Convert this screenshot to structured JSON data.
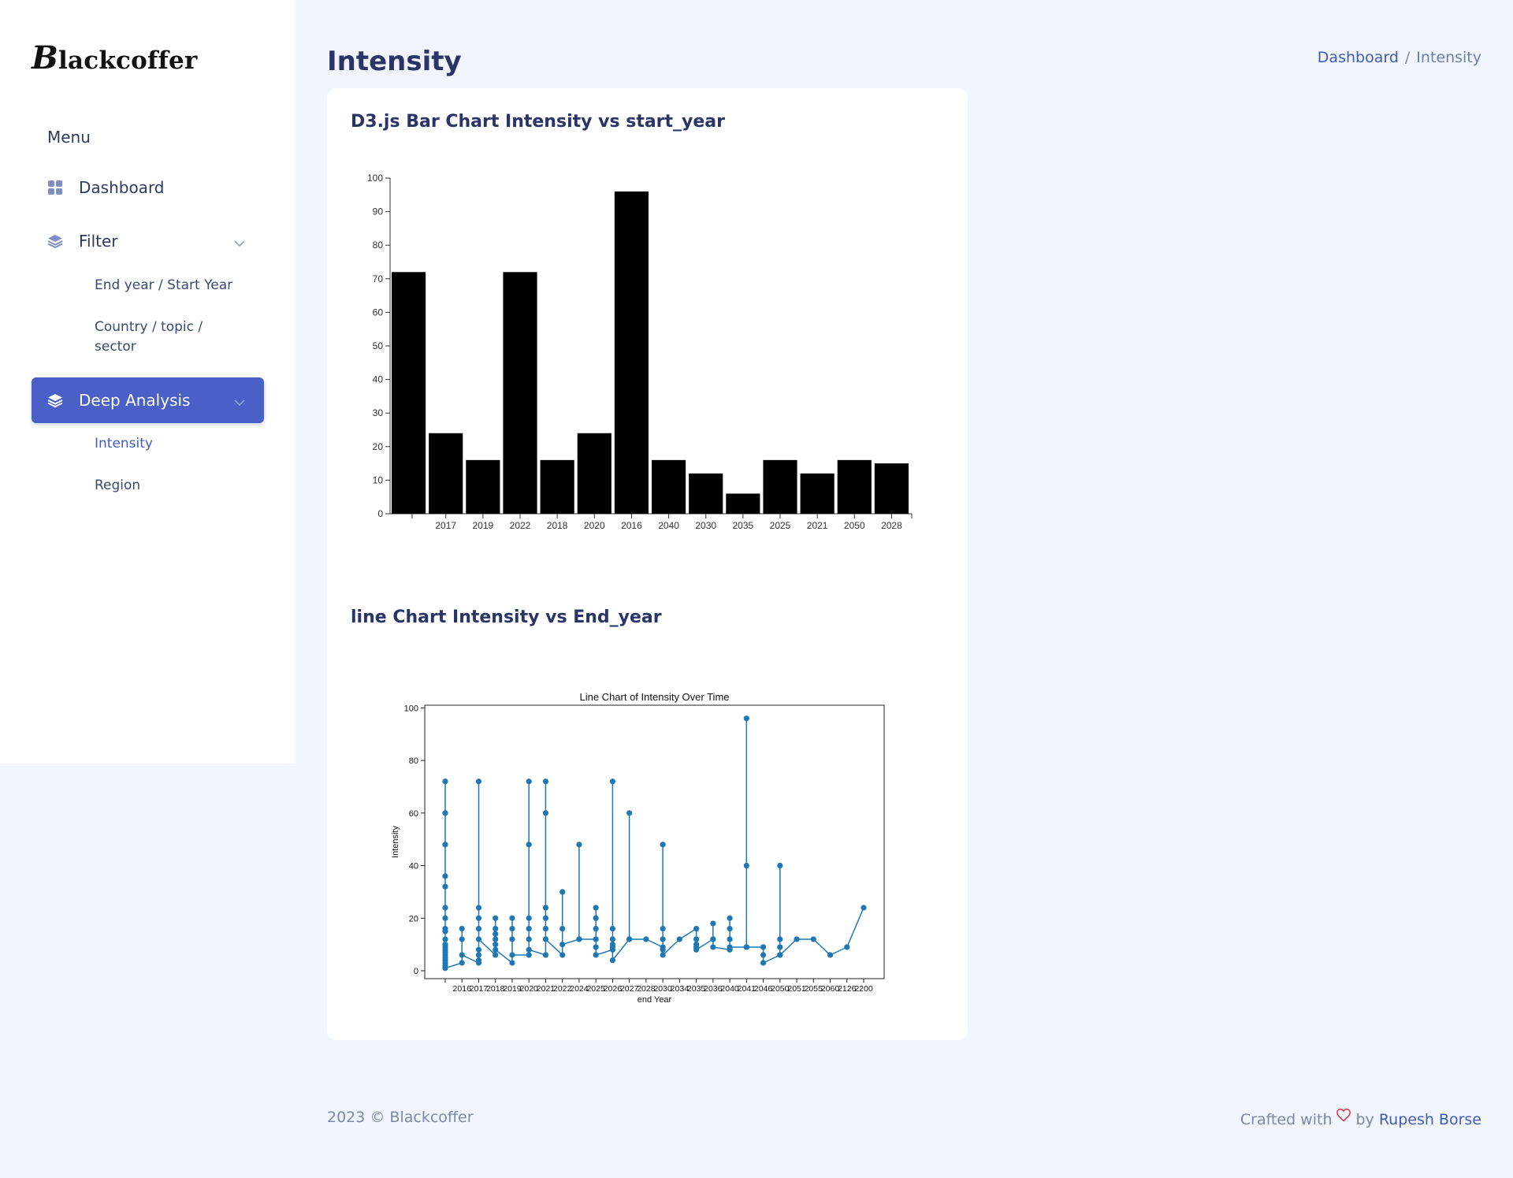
{
  "brand": {
    "logo_initial": "B",
    "logo_rest": "lackcoffer"
  },
  "sidebar": {
    "menu_title": "Menu",
    "dashboard": "Dashboard",
    "filter": "Filter",
    "filter_sub": [
      "End year / Start Year",
      "Country / topic / sector"
    ],
    "deep_analysis": "Deep Analysis",
    "deep_sub": [
      "Intensity",
      "Region"
    ]
  },
  "header": {
    "title": "Intensity",
    "breadcrumb": [
      "Dashboard",
      "Intensity"
    ],
    "separator": "/"
  },
  "sections": {
    "bar_title": "D3.js Bar Chart Intensity vs start_year",
    "line_title": "line Chart Intensity vs End_year"
  },
  "footer": {
    "copyright": "2023 © Blackcoffer",
    "crafted": "Crafted with",
    "by": "by",
    "author": "Rupesh Borse"
  },
  "colors": {
    "accent": "#4a60c6",
    "bar": "#000000",
    "line": "#1f77b4",
    "bg": "#f1f5fd"
  },
  "chart_data": [
    {
      "type": "bar",
      "categories": [
        "",
        "2017",
        "2019",
        "2022",
        "2018",
        "2020",
        "2016",
        "2040",
        "2030",
        "2035",
        "2025",
        "2021",
        "2050",
        "2028"
      ],
      "values": [
        72,
        24,
        16,
        72,
        16,
        24,
        96,
        16,
        12,
        6,
        16,
        12,
        16,
        15
      ],
      "ylim": [
        0,
        100
      ],
      "yticks": [
        0,
        10,
        20,
        30,
        40,
        50,
        60,
        70,
        80,
        90,
        100
      ]
    },
    {
      "type": "line",
      "title": "Line Chart of Intensity Over Time",
      "xlabel": "end Year",
      "ylabel": "Intensity",
      "categories": [
        "",
        "2016",
        "2017",
        "2018",
        "2019",
        "2020",
        "2021",
        "2022",
        "2024",
        "2025",
        "2026",
        "2027",
        "2028",
        "2030",
        "2034",
        "2035",
        "2036",
        "2040",
        "2041",
        "2046",
        "2050",
        "2051",
        "2055",
        "2060",
        "2126",
        "2200"
      ],
      "yticks": [
        0,
        20,
        40,
        60,
        80,
        100
      ],
      "ylim": [
        -3,
        101
      ],
      "points": [
        [
          0,
          72
        ],
        [
          0,
          60
        ],
        [
          0,
          48
        ],
        [
          0,
          36
        ],
        [
          0,
          32
        ],
        [
          0,
          24
        ],
        [
          0,
          20
        ],
        [
          0,
          16
        ],
        [
          0,
          15
        ],
        [
          0,
          12
        ],
        [
          0,
          10
        ],
        [
          0,
          9
        ],
        [
          0,
          8
        ],
        [
          0,
          7
        ],
        [
          0,
          6
        ],
        [
          0,
          5
        ],
        [
          0,
          4
        ],
        [
          0,
          3
        ],
        [
          0,
          2
        ],
        [
          0,
          1
        ],
        [
          1,
          3
        ],
        [
          1,
          16
        ],
        [
          1,
          12
        ],
        [
          1,
          6
        ],
        [
          2,
          3
        ],
        [
          2,
          72
        ],
        [
          2,
          24
        ],
        [
          2,
          20
        ],
        [
          2,
          16
        ],
        [
          2,
          8
        ],
        [
          2,
          6
        ],
        [
          2,
          4
        ],
        [
          2,
          12
        ],
        [
          3,
          6
        ],
        [
          3,
          20
        ],
        [
          3,
          16
        ],
        [
          3,
          14
        ],
        [
          3,
          12
        ],
        [
          3,
          10
        ],
        [
          3,
          8
        ],
        [
          4,
          3
        ],
        [
          4,
          20
        ],
        [
          4,
          16
        ],
        [
          4,
          12
        ],
        [
          4,
          6
        ],
        [
          5,
          6
        ],
        [
          5,
          72
        ],
        [
          5,
          48
        ],
        [
          5,
          20
        ],
        [
          5,
          16
        ],
        [
          5,
          12
        ],
        [
          5,
          8
        ],
        [
          6,
          6
        ],
        [
          6,
          72
        ],
        [
          6,
          60
        ],
        [
          6,
          24
        ],
        [
          6,
          20
        ],
        [
          6,
          16
        ],
        [
          6,
          12
        ],
        [
          7,
          6
        ],
        [
          7,
          30
        ],
        [
          7,
          16
        ],
        [
          7,
          10
        ],
        [
          8,
          12
        ],
        [
          8,
          48
        ],
        [
          8,
          12
        ],
        [
          9,
          12
        ],
        [
          9,
          24
        ],
        [
          9,
          20
        ],
        [
          9,
          16
        ],
        [
          9,
          9
        ],
        [
          9,
          6
        ],
        [
          10,
          8
        ],
        [
          10,
          72
        ],
        [
          10,
          16
        ],
        [
          10,
          12
        ],
        [
          10,
          10
        ],
        [
          10,
          9
        ],
        [
          10,
          4
        ],
        [
          11,
          12
        ],
        [
          11,
          60
        ],
        [
          11,
          12
        ],
        [
          12,
          12
        ],
        [
          13,
          9
        ],
        [
          13,
          48
        ],
        [
          13,
          16
        ],
        [
          13,
          12
        ],
        [
          13,
          8
        ],
        [
          13,
          6
        ],
        [
          14,
          12
        ],
        [
          15,
          16
        ],
        [
          15,
          12
        ],
        [
          15,
          10
        ],
        [
          15,
          9
        ],
        [
          15,
          8
        ],
        [
          16,
          12
        ],
        [
          16,
          18
        ],
        [
          16,
          12
        ],
        [
          16,
          9
        ],
        [
          17,
          8
        ],
        [
          17,
          20
        ],
        [
          17,
          16
        ],
        [
          17,
          12
        ],
        [
          17,
          9
        ],
        [
          18,
          9
        ],
        [
          18,
          96
        ],
        [
          18,
          40
        ],
        [
          18,
          9
        ],
        [
          19,
          9
        ],
        [
          19,
          6
        ],
        [
          19,
          3
        ],
        [
          20,
          6
        ],
        [
          20,
          40
        ],
        [
          20,
          12
        ],
        [
          20,
          9
        ],
        [
          20,
          6
        ],
        [
          21,
          12
        ],
        [
          22,
          12
        ],
        [
          23,
          6
        ],
        [
          24,
          9
        ],
        [
          25,
          24
        ]
      ]
    }
  ]
}
